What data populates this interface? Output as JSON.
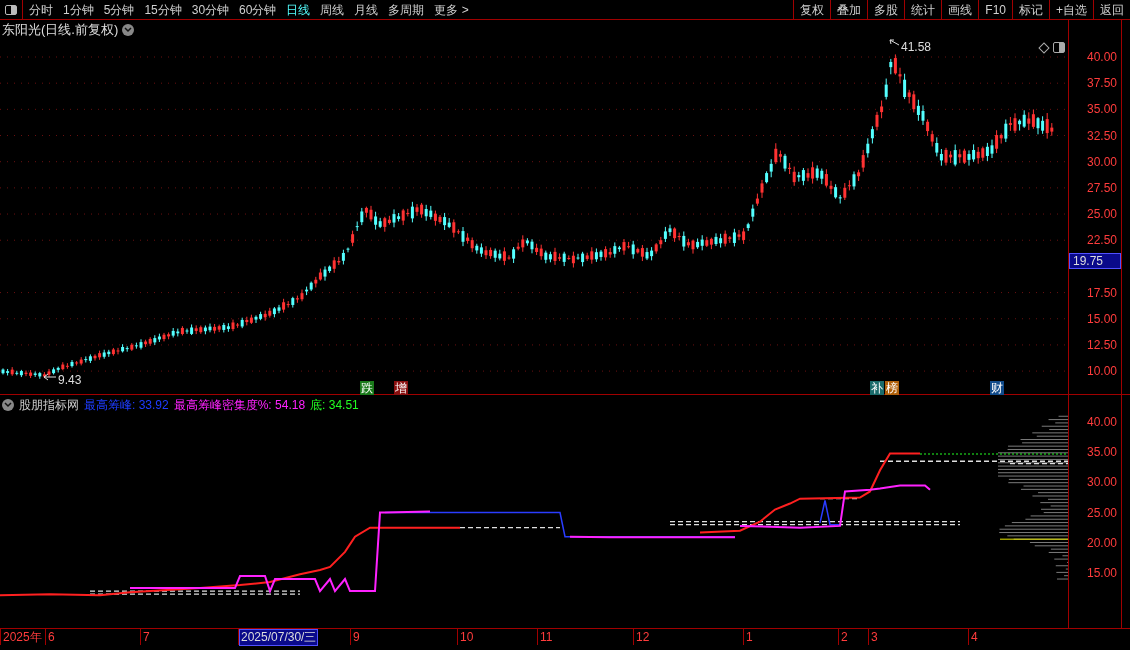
{
  "toolbar": {
    "periods": [
      {
        "label": "分时",
        "selected": false
      },
      {
        "label": "1分钟",
        "selected": false
      },
      {
        "label": "5分钟",
        "selected": false
      },
      {
        "label": "15分钟",
        "selected": false
      },
      {
        "label": "30分钟",
        "selected": false
      },
      {
        "label": "60分钟",
        "selected": false
      },
      {
        "label": "日线",
        "selected": true
      },
      {
        "label": "周线",
        "selected": false
      },
      {
        "label": "月线",
        "selected": false
      },
      {
        "label": "多周期",
        "selected": false
      },
      {
        "label": "更多 >",
        "selected": false
      }
    ],
    "actions": [
      "复权",
      "叠加",
      "多股",
      "统计",
      "画线",
      "F10",
      "标记",
      "+自选",
      "返回"
    ]
  },
  "chart": {
    "title": "东阳光(日线.前复权)",
    "high_label": "41.58",
    "low_label": "9.43",
    "event_badges": [
      {
        "label": "跌",
        "color": "#1a7a1a"
      },
      {
        "label": "增",
        "color": "#8a1010"
      },
      {
        "label": "补",
        "color": "#1a6b6b"
      },
      {
        "label": "榜",
        "color": "#b0600a"
      },
      {
        "label": "财",
        "color": "#104a8a"
      }
    ]
  },
  "price_axis": {
    "ticks": [
      "40.00",
      "37.50",
      "35.00",
      "32.50",
      "30.00",
      "27.50",
      "25.00",
      "22.50",
      "17.50",
      "15.00",
      "12.50",
      "10.00"
    ],
    "current_price": "19.75"
  },
  "indicator": {
    "name": "股朋指标网",
    "readings": [
      {
        "label": "最高筹峰: 33.92",
        "color": "#1e3cff"
      },
      {
        "label": "最高筹峰密集度%: 54.18",
        "color": "#ff22ff"
      },
      {
        "label": "底: 34.51",
        "color": "#22ff22"
      }
    ],
    "ticks": [
      "40.00",
      "35.00",
      "30.00",
      "25.00",
      "20.00",
      "15.00"
    ]
  },
  "date_axis": [
    {
      "label": "2025年",
      "selected": false
    },
    {
      "label": "6",
      "selected": false
    },
    {
      "label": "7",
      "selected": false
    },
    {
      "label": "2025/07/30/三",
      "selected": true
    },
    {
      "label": "9",
      "selected": false
    },
    {
      "label": "10",
      "selected": false
    },
    {
      "label": "11",
      "selected": false
    },
    {
      "label": "12",
      "selected": false
    },
    {
      "label": "1",
      "selected": false
    },
    {
      "label": "2",
      "selected": false
    },
    {
      "label": "3",
      "selected": false
    },
    {
      "label": "4",
      "selected": false
    }
  ]
}
